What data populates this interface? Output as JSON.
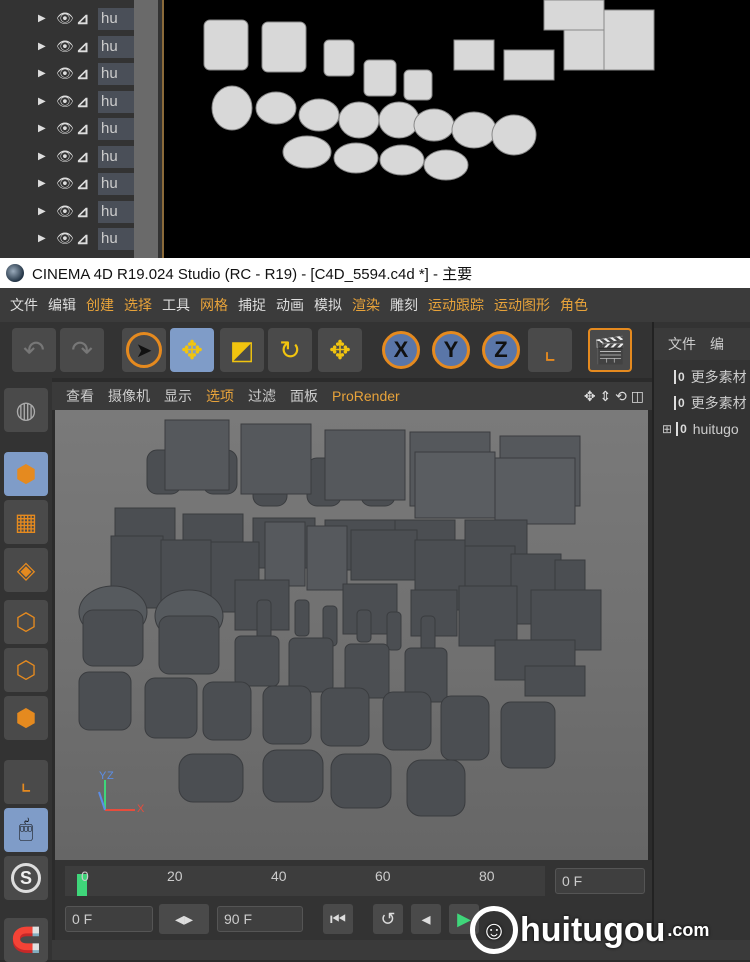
{
  "object_list": {
    "items": [
      {
        "label": "hu"
      },
      {
        "label": "hu"
      },
      {
        "label": "hu"
      },
      {
        "label": "hu"
      },
      {
        "label": "hu"
      },
      {
        "label": "hu"
      },
      {
        "label": "hu"
      },
      {
        "label": "hu"
      },
      {
        "label": "hu"
      }
    ]
  },
  "titlebar": {
    "title": "CINEMA 4D R19.024 Studio (RC - R19) - [C4D_5594.c4d *] - 主要"
  },
  "menubar": {
    "items": [
      {
        "label": "文件"
      },
      {
        "label": "编辑"
      },
      {
        "label": "创建"
      },
      {
        "label": "选择"
      },
      {
        "label": "工具"
      },
      {
        "label": "网格"
      },
      {
        "label": "捕捉"
      },
      {
        "label": "动画"
      },
      {
        "label": "模拟"
      },
      {
        "label": "渲染"
      },
      {
        "label": "雕刻"
      },
      {
        "label": "运动跟踪"
      },
      {
        "label": "运动图形"
      },
      {
        "label": "角色"
      }
    ]
  },
  "viewport_menu": {
    "items": [
      {
        "label": "查看"
      },
      {
        "label": "摄像机"
      },
      {
        "label": "显示"
      },
      {
        "label": "选项"
      },
      {
        "label": "过滤"
      },
      {
        "label": "面板"
      },
      {
        "label": "ProRender"
      }
    ]
  },
  "axis": {
    "x": "X",
    "y": "Y",
    "z": "Z"
  },
  "right_panel": {
    "tabs": [
      {
        "label": "文件"
      },
      {
        "label": "编"
      }
    ],
    "items": [
      {
        "label": "更多素材"
      },
      {
        "label": "更多素材"
      },
      {
        "label": "huitugo"
      }
    ]
  },
  "timeline": {
    "ticks": [
      "0",
      "20",
      "40",
      "60",
      "80"
    ],
    "end_frame_field": "0 F",
    "current_field": "0 F",
    "max_field": "90 F"
  },
  "watermark": {
    "brand": "huitugou",
    "suffix": ".com"
  },
  "colors": {
    "accent_orange": "#e58a1f",
    "select_blue": "#7f9cc8",
    "playhead_green": "#3fd67a"
  }
}
